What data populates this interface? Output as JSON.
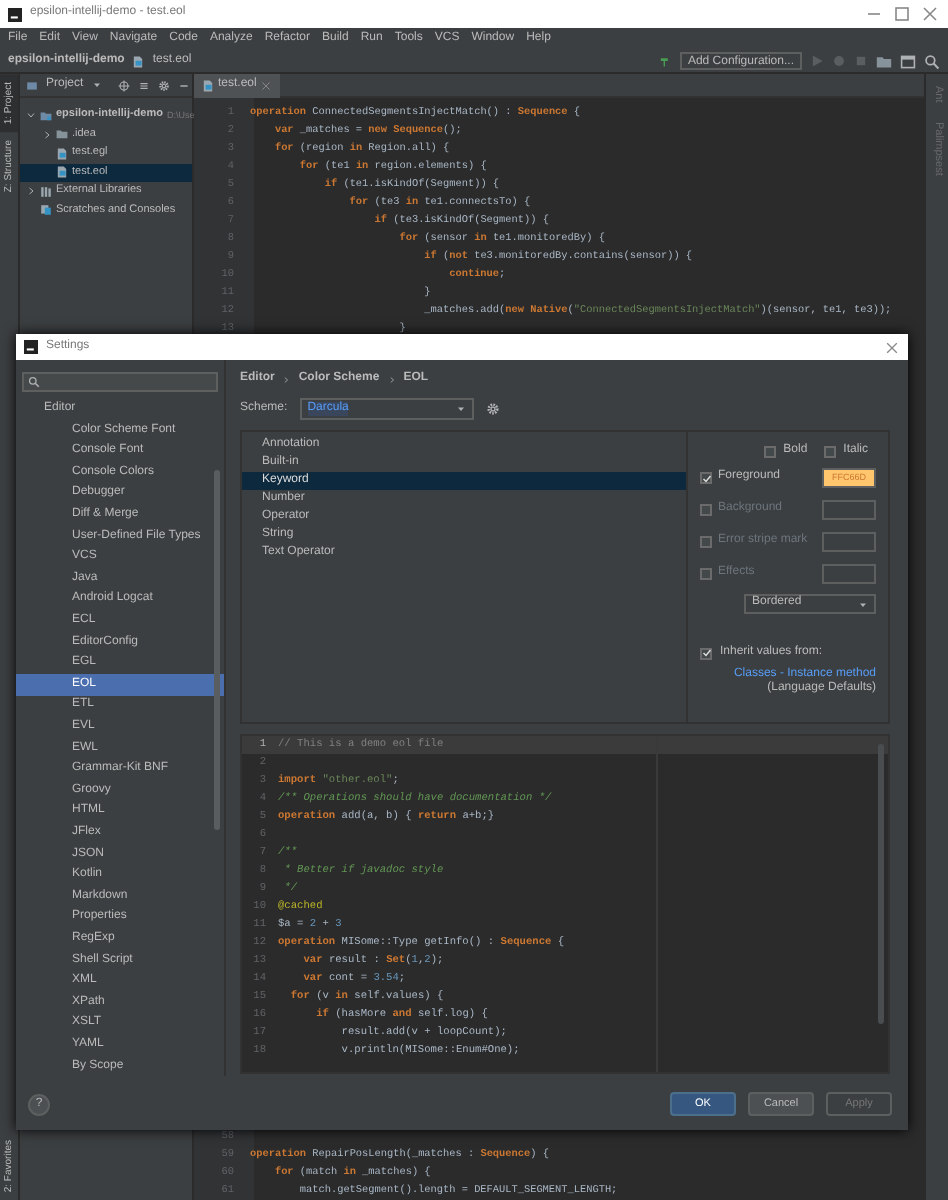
{
  "window": {
    "title": "epsilon-intellij-demo - test.eol"
  },
  "menu": [
    "File",
    "Edit",
    "View",
    "Navigate",
    "Code",
    "Analyze",
    "Refactor",
    "Build",
    "Run",
    "Tools",
    "VCS",
    "Window",
    "Help"
  ],
  "navbar": {
    "breadcrumbs": [
      "epsilon-intellij-demo",
      "test.eol"
    ],
    "run_config": "Add Configuration..."
  },
  "left_strip": [
    {
      "label": "1: Project",
      "selected": true
    },
    {
      "label": "Z: Structure",
      "selected": false
    }
  ],
  "left_strip_bottom": [
    {
      "label": "2: Favorites",
      "selected": false
    }
  ],
  "right_strip": [
    {
      "label": "Ant"
    },
    {
      "label": "Palimpsest"
    }
  ],
  "project": {
    "title": "Project",
    "tree": [
      {
        "label": "epsilon-intellij-demo",
        "hint": "D:\\Use",
        "kind": "module",
        "expanded": true,
        "selected": false,
        "children": [
          {
            "label": ".idea",
            "kind": "folder",
            "expanded": false,
            "selected": false
          },
          {
            "label": "test.egl",
            "kind": "file",
            "selected": false
          },
          {
            "label": "test.eol",
            "kind": "file",
            "selected": true
          }
        ]
      },
      {
        "label": "External Libraries",
        "kind": "library",
        "expanded": false,
        "selected": false
      },
      {
        "label": "Scratches and Consoles",
        "kind": "scratch",
        "selected": false
      }
    ]
  },
  "editor": {
    "tab": "test.eol",
    "lines": [
      {
        "number": "1",
        "tokens": [
          {
            "text": "operation",
            "kind": "keyword"
          },
          {
            "text": " ConnectedSegmentsInjectMatch() : ",
            "kind": "plain"
          },
          {
            "text": "Sequence",
            "kind": "keyword"
          },
          {
            "text": " {",
            "kind": "plain"
          }
        ]
      },
      {
        "number": "2",
        "tokens": [
          {
            "text": "    var",
            "kind": "keyword"
          },
          {
            "text": " _matches = ",
            "kind": "plain"
          },
          {
            "text": "new Sequence",
            "kind": "keyword"
          },
          {
            "text": "();",
            "kind": "plain"
          }
        ]
      },
      {
        "number": "3",
        "tokens": [
          {
            "text": "    for",
            "kind": "keyword"
          },
          {
            "text": " (region ",
            "kind": "plain"
          },
          {
            "text": "in",
            "kind": "keyword"
          },
          {
            "text": " Region.all) {",
            "kind": "plain"
          }
        ]
      },
      {
        "number": "4",
        "tokens": [
          {
            "text": "        for",
            "kind": "keyword"
          },
          {
            "text": " (te1 ",
            "kind": "plain"
          },
          {
            "text": "in",
            "kind": "keyword"
          },
          {
            "text": " region.elements) {",
            "kind": "plain"
          }
        ]
      },
      {
        "number": "5",
        "tokens": [
          {
            "text": "            if",
            "kind": "keyword"
          },
          {
            "text": " (te1.isKindOf(Segment)) {",
            "kind": "plain"
          }
        ]
      },
      {
        "number": "6",
        "tokens": [
          {
            "text": "                for",
            "kind": "keyword"
          },
          {
            "text": " (te3 ",
            "kind": "plain"
          },
          {
            "text": "in",
            "kind": "keyword"
          },
          {
            "text": " te1.connectsTo) {",
            "kind": "plain"
          }
        ]
      },
      {
        "number": "7",
        "tokens": [
          {
            "text": "                    if",
            "kind": "keyword"
          },
          {
            "text": " (te3.isKindOf(Segment)) {",
            "kind": "plain"
          }
        ]
      },
      {
        "number": "8",
        "tokens": [
          {
            "text": "                        for",
            "kind": "keyword"
          },
          {
            "text": " (sensor ",
            "kind": "plain"
          },
          {
            "text": "in",
            "kind": "keyword"
          },
          {
            "text": " te1.monitoredBy) {",
            "kind": "plain"
          }
        ]
      },
      {
        "number": "9",
        "tokens": [
          {
            "text": "                            if",
            "kind": "keyword"
          },
          {
            "text": " (",
            "kind": "plain"
          },
          {
            "text": "not",
            "kind": "keyword"
          },
          {
            "text": " te3.monitoredBy.contains(sensor)) {",
            "kind": "plain"
          }
        ]
      },
      {
        "number": "10",
        "tokens": [
          {
            "text": "                                continue",
            "kind": "keyword"
          },
          {
            "text": ";",
            "kind": "plain"
          }
        ]
      },
      {
        "number": "11",
        "tokens": [
          {
            "text": "                            }",
            "kind": "plain"
          }
        ]
      },
      {
        "number": "12",
        "tokens": [
          {
            "text": "                            _matches.add(",
            "kind": "plain"
          },
          {
            "text": "new Native",
            "kind": "keyword"
          },
          {
            "text": "(",
            "kind": "plain"
          },
          {
            "text": "\"ConnectedSegmentsInjectMatch\"",
            "kind": "string"
          },
          {
            "text": ")(sensor, te1, te3));",
            "kind": "plain"
          }
        ]
      },
      {
        "number": "13",
        "tokens": [
          {
            "text": "                        }",
            "kind": "plain"
          }
        ]
      }
    ],
    "lines_below": [
      {
        "number": "58"
      },
      {
        "number": "59",
        "tokens": [
          {
            "text": "operation",
            "kind": "keyword"
          },
          {
            "text": " RepairPosLength(_matches : ",
            "kind": "plain"
          },
          {
            "text": "Sequence",
            "kind": "keyword"
          },
          {
            "text": ") {",
            "kind": "plain"
          }
        ]
      },
      {
        "number": "60",
        "tokens": [
          {
            "text": "    for",
            "kind": "keyword"
          },
          {
            "text": " (match ",
            "kind": "plain"
          },
          {
            "text": "in",
            "kind": "keyword"
          },
          {
            "text": " _matches) {",
            "kind": "plain"
          }
        ]
      },
      {
        "number": "61",
        "tokens": [
          {
            "text": "        match.getSegment().length = DEFAULT_SEGMENT_LENGTH;",
            "kind": "plain"
          }
        ]
      }
    ]
  },
  "settings": {
    "title": "Settings",
    "nav": {
      "section": "Editor",
      "items": [
        {
          "label": "Color Scheme Font",
          "selected": false
        },
        {
          "label": "Console Font",
          "selected": false
        },
        {
          "label": "Console Colors",
          "selected": false
        },
        {
          "label": "Debugger",
          "selected": false
        },
        {
          "label": "Diff & Merge",
          "selected": false
        },
        {
          "label": "User-Defined File Types",
          "selected": false
        },
        {
          "label": "VCS",
          "selected": false
        },
        {
          "label": "Java",
          "selected": false
        },
        {
          "label": "Android Logcat",
          "selected": false
        },
        {
          "label": "ECL",
          "selected": false
        },
        {
          "label": "EditorConfig",
          "selected": false
        },
        {
          "label": "EGL",
          "selected": false
        },
        {
          "label": "EOL",
          "selected": true
        },
        {
          "label": "ETL",
          "selected": false
        },
        {
          "label": "EVL",
          "selected": false
        },
        {
          "label": "EWL",
          "selected": false
        },
        {
          "label": "Grammar-Kit BNF",
          "selected": false
        },
        {
          "label": "Groovy",
          "selected": false
        },
        {
          "label": "HTML",
          "selected": false
        },
        {
          "label": "JFlex",
          "selected": false
        },
        {
          "label": "JSON",
          "selected": false
        },
        {
          "label": "Kotlin",
          "selected": false
        },
        {
          "label": "Markdown",
          "selected": false
        },
        {
          "label": "Properties",
          "selected": false
        },
        {
          "label": "RegExp",
          "selected": false
        },
        {
          "label": "Shell Script",
          "selected": false
        },
        {
          "label": "XML",
          "selected": false
        },
        {
          "label": "XPath",
          "selected": false
        },
        {
          "label": "XSLT",
          "selected": false
        },
        {
          "label": "YAML",
          "selected": false
        },
        {
          "label": "By Scope",
          "selected": false
        }
      ]
    },
    "breadcrumb": [
      "Editor",
      "Color Scheme",
      "EOL"
    ],
    "scheme": {
      "label": "Scheme:",
      "value": "Darcula"
    },
    "attributes": [
      {
        "label": "Annotation",
        "selected": false
      },
      {
        "label": "Built-in",
        "selected": false
      },
      {
        "label": "Keyword",
        "selected": true
      },
      {
        "label": "Number",
        "selected": false
      },
      {
        "label": "Operator",
        "selected": false
      },
      {
        "label": "String",
        "selected": false
      },
      {
        "label": "Text Operator",
        "selected": false
      }
    ],
    "font_style": [
      {
        "label": "Bold",
        "checked": false
      },
      {
        "label": "Italic",
        "checked": false
      }
    ],
    "colors": [
      {
        "label": "Foreground",
        "checked": true,
        "value": "FFC66D",
        "color": "#ffc66d"
      },
      {
        "label": "Background",
        "checked": false
      },
      {
        "label": "Error stripe mark",
        "checked": false
      },
      {
        "label": "Effects",
        "checked": false
      }
    ],
    "effect_style": "Bordered",
    "inherit": {
      "label": "Inherit values from:",
      "checked": true,
      "link": "Classes - Instance method",
      "note": "(Language Defaults)"
    },
    "preview": [
      {
        "number": "1",
        "current": true,
        "tokens": [
          {
            "text": "// This is a demo eol file",
            "kind": "comment"
          }
        ]
      },
      {
        "number": "2",
        "current": false
      },
      {
        "number": "3",
        "current": false,
        "tokens": [
          {
            "text": "import",
            "kind": "keyword"
          },
          {
            "text": " \"other.eol\"",
            "kind": "string"
          },
          {
            "text": ";",
            "kind": "plain"
          }
        ]
      },
      {
        "number": "4",
        "current": false,
        "tokens": [
          {
            "text": "/** Operations should have documentation */",
            "kind": "doc"
          }
        ]
      },
      {
        "number": "5",
        "current": false,
        "tokens": [
          {
            "text": "operation",
            "kind": "keyword"
          },
          {
            "text": " add(a, b) { ",
            "kind": "plain"
          },
          {
            "text": "return",
            "kind": "keyword"
          },
          {
            "text": " a+b;}",
            "kind": "plain"
          }
        ]
      },
      {
        "number": "6",
        "current": false
      },
      {
        "number": "7",
        "current": false,
        "tokens": [
          {
            "text": "/**",
            "kind": "doc"
          }
        ]
      },
      {
        "number": "8",
        "current": false,
        "tokens": [
          {
            "text": " * Better if javadoc style",
            "kind": "doc"
          }
        ]
      },
      {
        "number": "9",
        "current": false,
        "tokens": [
          {
            "text": " */",
            "kind": "doc"
          }
        ]
      },
      {
        "number": "10",
        "current": false,
        "tokens": [
          {
            "text": "@cached",
            "kind": "meta"
          }
        ]
      },
      {
        "number": "11",
        "current": false,
        "tokens": [
          {
            "text": "$a = ",
            "kind": "plain"
          },
          {
            "text": "2",
            "kind": "number"
          },
          {
            "text": " + ",
            "kind": "plain"
          },
          {
            "text": "3",
            "kind": "number"
          }
        ]
      },
      {
        "number": "12",
        "current": false,
        "tokens": [
          {
            "text": "operation",
            "kind": "keyword"
          },
          {
            "text": " MISome::Type getInfo() : ",
            "kind": "plain"
          },
          {
            "text": "Sequence",
            "kind": "keyword"
          },
          {
            "text": " {",
            "kind": "plain"
          }
        ]
      },
      {
        "number": "13",
        "current": false,
        "tokens": [
          {
            "text": "    var",
            "kind": "keyword"
          },
          {
            "text": " result : ",
            "kind": "plain"
          },
          {
            "text": "Set",
            "kind": "keyword"
          },
          {
            "text": "(",
            "kind": "plain"
          },
          {
            "text": "1",
            "kind": "number"
          },
          {
            "text": ",",
            "kind": "plain"
          },
          {
            "text": "2",
            "kind": "number"
          },
          {
            "text": ");",
            "kind": "plain"
          }
        ]
      },
      {
        "number": "14",
        "current": false,
        "tokens": [
          {
            "text": "    var",
            "kind": "keyword"
          },
          {
            "text": " cont = ",
            "kind": "plain"
          },
          {
            "text": "3.54",
            "kind": "number"
          },
          {
            "text": ";",
            "kind": "plain"
          }
        ]
      },
      {
        "number": "15",
        "current": false,
        "tokens": [
          {
            "text": "  for",
            "kind": "keyword"
          },
          {
            "text": " (v ",
            "kind": "plain"
          },
          {
            "text": "in",
            "kind": "keyword"
          },
          {
            "text": " self.values) {",
            "kind": "plain"
          }
        ]
      },
      {
        "number": "16",
        "current": false,
        "tokens": [
          {
            "text": "      if",
            "kind": "keyword"
          },
          {
            "text": " (hasMore ",
            "kind": "plain"
          },
          {
            "text": "and",
            "kind": "keyword"
          },
          {
            "text": " self.log) {",
            "kind": "plain"
          }
        ]
      },
      {
        "number": "17",
        "current": false,
        "tokens": [
          {
            "text": "          result.add(v + loopCount);",
            "kind": "plain"
          }
        ]
      },
      {
        "number": "18",
        "current": false,
        "tokens": [
          {
            "text": "          v.println(MISome::Enum#One);",
            "kind": "plain"
          }
        ]
      }
    ],
    "help": "?",
    "buttons": [
      {
        "label": "OK",
        "kind": "primary",
        "disabled": false
      },
      {
        "label": "Cancel",
        "kind": "default",
        "disabled": false
      },
      {
        "label": "Apply",
        "kind": "default",
        "disabled": true
      }
    ]
  }
}
